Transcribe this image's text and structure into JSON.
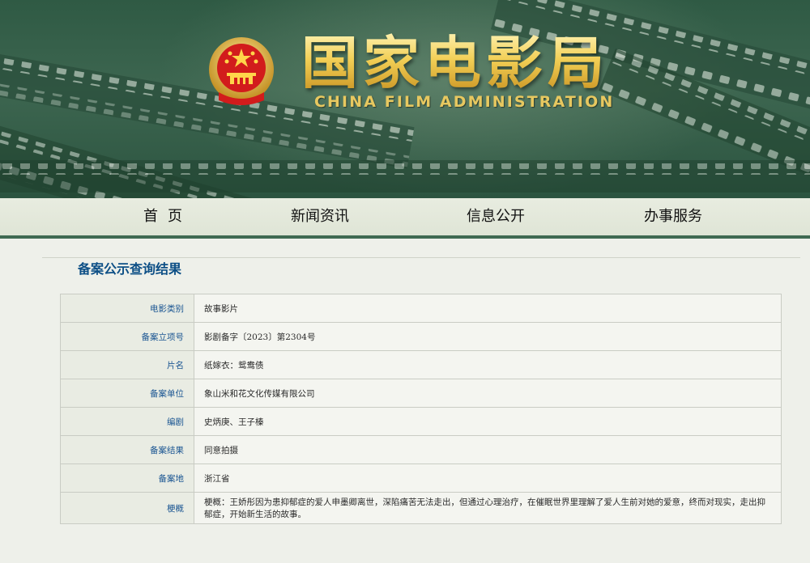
{
  "header": {
    "title": "国家电影局",
    "subtitle": "CHINA FILM ADMINISTRATION",
    "emblem_icon": "national-emblem-icon"
  },
  "nav": {
    "items": [
      {
        "label": "首页"
      },
      {
        "label": "新闻资讯"
      },
      {
        "label": "信息公开"
      },
      {
        "label": "办事服务"
      }
    ]
  },
  "page": {
    "title": "备案公示查询结果"
  },
  "record": {
    "rows": [
      {
        "label": "电影类别",
        "value": "故事影片"
      },
      {
        "label": "备案立项号",
        "value": "影剧备字〔2023〕第2304号"
      },
      {
        "label": "片名",
        "value": "纸嫁衣：鸳鸯债"
      },
      {
        "label": "备案单位",
        "value": "象山米和花文化传媒有限公司"
      },
      {
        "label": "编剧",
        "value": "史炳庚、王子榛"
      },
      {
        "label": "备案结果",
        "value": "同意拍摄"
      },
      {
        "label": "备案地",
        "value": "浙江省"
      },
      {
        "label": "梗概",
        "value": "梗概：王娇彤因为患抑郁症的爱人申墨卿离世，深陷痛苦无法走出，但通过心理治疗，在催眠世界里理解了爱人生前对她的爱意，终而对现实，走出抑郁症，开始新生活的故事。"
      }
    ]
  },
  "colors": {
    "banner_green": "#2f5a44",
    "nav_border": "#3f6a52",
    "label_blue": "#1a5592",
    "title_blue": "#0d4f86",
    "title_gold": "#f1d466"
  }
}
